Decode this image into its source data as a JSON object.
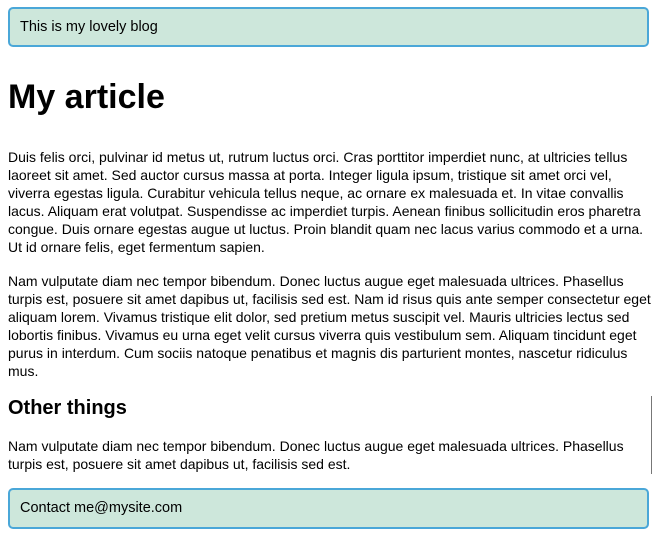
{
  "header": {
    "text": "This is my lovely blog"
  },
  "article": {
    "title": "My article",
    "paragraphs": [
      "Duis felis orci, pulvinar id metus ut, rutrum luctus orci. Cras porttitor imperdiet nunc, at ultricies tellus laoreet sit amet. Sed auctor cursus massa at porta. Integer ligula ipsum, tristique sit amet orci vel, viverra egestas ligula. Curabitur vehicula tellus neque, ac ornare ex malesuada et. In vitae convallis lacus. Aliquam erat volutpat. Suspendisse ac imperdiet turpis. Aenean finibus sollicitudin eros pharetra congue. Duis ornare egestas augue ut luctus. Proin blandit quam nec lacus varius commodo et a urna. Ut id ornare felis, eget fermentum sapien.",
      "Nam vulputate diam nec tempor bibendum. Donec luctus augue eget malesuada ultrices. Phasellus turpis est, posuere sit amet dapibus ut, facilisis sed est. Nam id risus quis ante semper consectetur eget aliquam lorem. Vivamus tristique elit dolor, sed pretium metus suscipit vel. Mauris ultricies lectus sed lobortis finibus. Vivamus eu urna eget velit cursus viverra quis vestibulum sem. Aliquam tincidunt eget purus in interdum. Cum sociis natoque penatibus et magnis dis parturient montes, nascetur ridiculus mus."
    ]
  },
  "section": {
    "title": "Other things",
    "paragraph": "Nam vulputate diam nec tempor bibendum. Donec luctus augue eget malesuada ultrices. Phasellus turpis est, posuere sit amet dapibus ut, facilisis sed est."
  },
  "footer": {
    "text": "Contact me@mysite.com"
  },
  "colors": {
    "box_background": "#cde7db",
    "box_border": "#4aa7d8",
    "text": "#000000"
  }
}
